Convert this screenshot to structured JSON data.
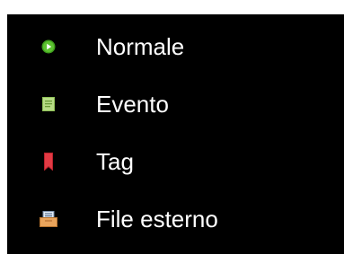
{
  "menu": {
    "items": [
      {
        "label": "Normale",
        "icon": "play-circle-icon",
        "icon_color": "#4caf22"
      },
      {
        "label": "Evento",
        "icon": "event-note-icon",
        "icon_color": "#a9d37a"
      },
      {
        "label": "Tag",
        "icon": "bookmark-tag-icon",
        "icon_color": "#e0303a"
      },
      {
        "label": "File esterno",
        "icon": "external-file-icon",
        "icon_color": "#e8a25a"
      }
    ]
  }
}
